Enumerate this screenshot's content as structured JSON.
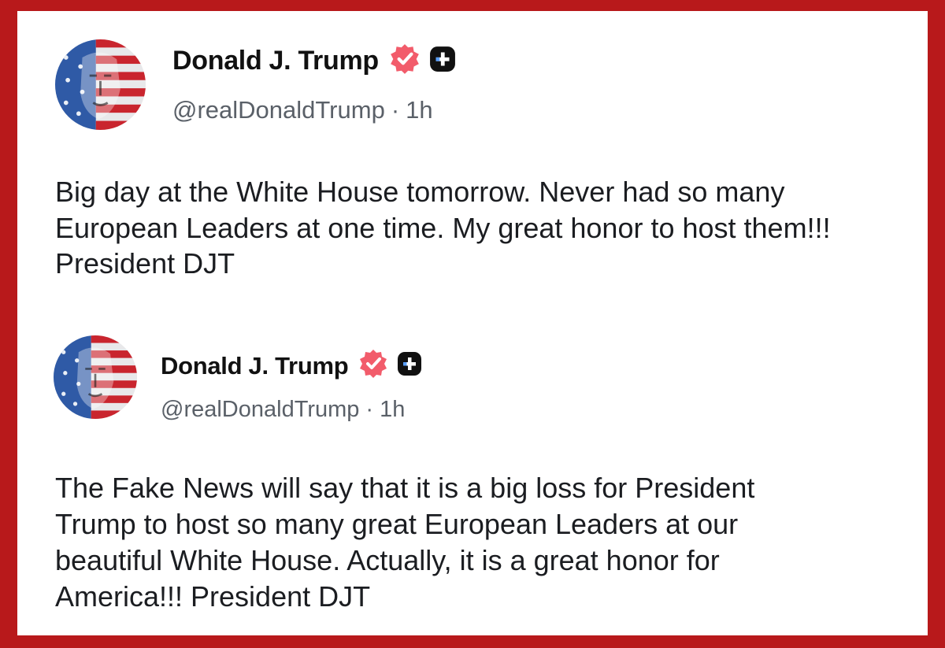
{
  "posts": [
    {
      "author": "Donald J. Trump",
      "handle": "@realDonaldTrump",
      "separator": "·",
      "time": "1h",
      "text": "Big day at the White House tomorrow. Never had so many European Leaders at one time. My great honor to host them!!! President DJT",
      "icons": {
        "avatar": "flag-portrait-avatar",
        "verified": "verified-badge-icon",
        "plus": "plus-badge-icon"
      }
    },
    {
      "author": "Donald J. Trump",
      "handle": "@realDonaldTrump",
      "separator": "·",
      "time": "1h",
      "text": "The Fake News will say that it is a big loss for President Trump to host so many great European Leaders at our beautiful White House. Actually, it is a great honor for America!!! President DJT",
      "icons": {
        "avatar": "flag-portrait-avatar",
        "verified": "verified-badge-icon",
        "plus": "plus-badge-icon"
      }
    }
  ],
  "colors": {
    "frame_border": "#b8191b",
    "verified_badge": "#f25c6b",
    "plus_badge": "#111111",
    "handle_text": "#5a6068",
    "body_text": "#1b1d21"
  }
}
